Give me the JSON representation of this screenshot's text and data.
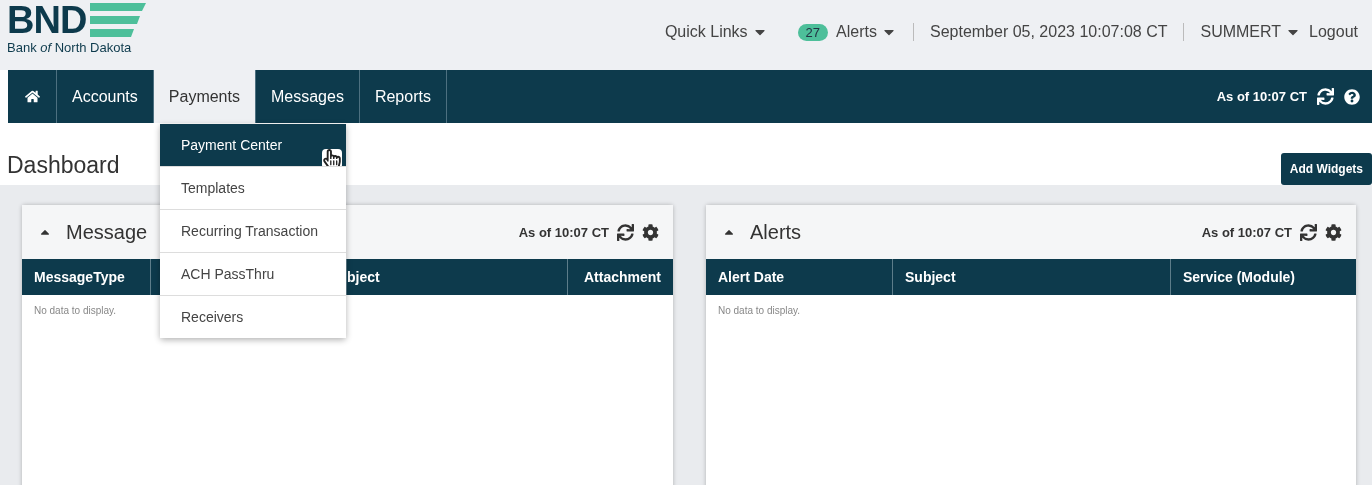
{
  "logo": {
    "mark": "BND",
    "name": "Bank *of* North Dakota"
  },
  "top_links": {
    "quick_links": "Quick Links",
    "alerts_count": "27",
    "alerts": "Alerts",
    "datetime": "September 05, 2023 10:07:08 CT",
    "user": "SUMMERT",
    "logout": "Logout"
  },
  "nav": {
    "tabs": [
      {
        "label": "Accounts",
        "selected": false
      },
      {
        "label": "Payments",
        "selected": true
      },
      {
        "label": "Messages",
        "selected": false
      },
      {
        "label": "Reports",
        "selected": false
      }
    ],
    "as_of": "As of 10:07 CT"
  },
  "payments_menu": {
    "items": [
      {
        "label": "Payment Center",
        "selected": true
      },
      {
        "label": "Templates",
        "selected": false
      },
      {
        "label": "Recurring Transaction",
        "selected": false
      },
      {
        "label": "ACH PassThru",
        "selected": false
      },
      {
        "label": "Receivers",
        "selected": false
      }
    ]
  },
  "page_title": "Dashboard",
  "add_widgets": "Add Widgets",
  "widgets": [
    {
      "title": "Message",
      "as_of": "As of 10:07 CT",
      "columns": [
        {
          "label": "MessageType"
        },
        {
          "label": "bject"
        },
        {
          "label": "Attachment"
        }
      ],
      "empty": "No data to display."
    },
    {
      "title": "Alerts",
      "as_of": "As of 10:07 CT",
      "columns": [
        {
          "label": "Alert Date"
        },
        {
          "label": "Subject"
        },
        {
          "label": "Service (Module)"
        }
      ],
      "empty": "No data to display."
    }
  ]
}
